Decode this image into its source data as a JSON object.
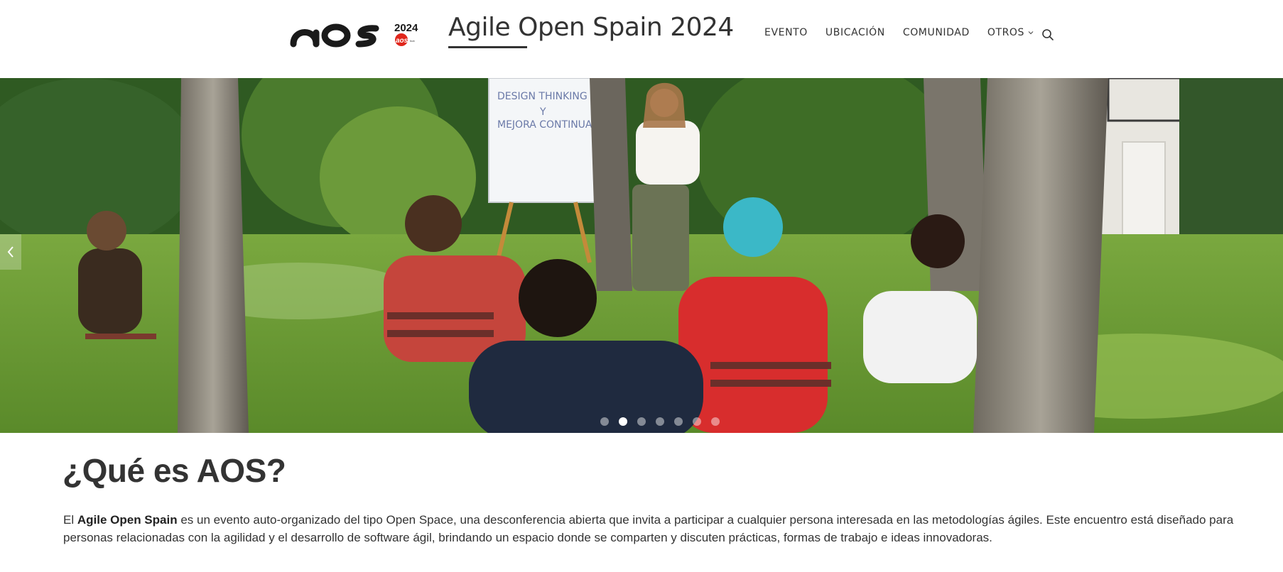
{
  "header": {
    "logo": {
      "text": "AOS",
      "year": "2024",
      "badge": "aos",
      "colors": {
        "main": "#1a1a1a",
        "accent": "#e0261b"
      }
    },
    "site_title": "Agile Open Spain 2024",
    "nav": [
      {
        "label": "EVENTO"
      },
      {
        "label": "UBICACIÓN"
      },
      {
        "label": "COMUNIDAD"
      },
      {
        "label": "OTROS",
        "has_dropdown": true
      }
    ],
    "search_icon": "search-icon"
  },
  "hero": {
    "flipchart_lines": [
      "DESIGN THINKING",
      "Y",
      "MEJORA CONTINUA"
    ],
    "prev_icon": "chevron-left-icon",
    "slide_count": 7,
    "active_slide": 2
  },
  "about": {
    "title": "¿Qué es AOS?",
    "intro_prefix": "El ",
    "intro_bold": "Agile Open Spain",
    "intro_rest": " es un evento auto-organizado del tipo Open Space, una desconferencia abierta que invita a participar a cualquier persona interesada en las metodologías ágiles. Este encuentro está diseñado para personas relacionadas con la agilidad y el desarrollo de software ágil, brindando un espacio donde se comparten y discuten prácticas, formas de trabajo e ideas innovadoras."
  }
}
